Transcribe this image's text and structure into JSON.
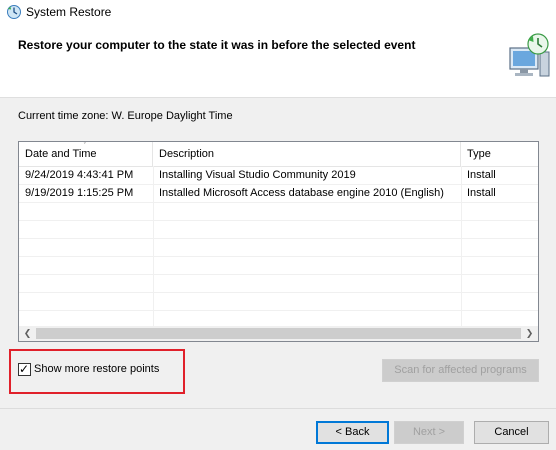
{
  "window": {
    "title": "System Restore"
  },
  "header": {
    "heading": "Restore your computer to the state it was in before the selected event"
  },
  "timezone": {
    "label": "Current time zone: W. Europe Daylight Time"
  },
  "table": {
    "columns": [
      "Date and Time",
      "Description",
      "Type"
    ],
    "rows": [
      {
        "date": "9/24/2019 4:43:41 PM",
        "description": "Installing Visual Studio Community 2019",
        "type": "Install"
      },
      {
        "date": "9/19/2019 1:15:25 PM",
        "description": "Installed Microsoft Access database engine 2010 (English)",
        "type": "Install"
      }
    ]
  },
  "show_more": {
    "label": "Show more restore points",
    "checked": true
  },
  "buttons": {
    "scan": "Scan for affected programs",
    "back": "< Back",
    "next": "Next >",
    "cancel": "Cancel"
  },
  "colors": {
    "highlight": "#e0202a",
    "focus": "#0078d7"
  },
  "icons": {
    "app": "system-restore-icon",
    "header": "computer-restore-icon",
    "sort": "sort-descending-icon",
    "scroll_left": "scroll-left-arrow-icon",
    "scroll_right": "scroll-right-arrow-icon",
    "check": "checkmark-icon"
  }
}
